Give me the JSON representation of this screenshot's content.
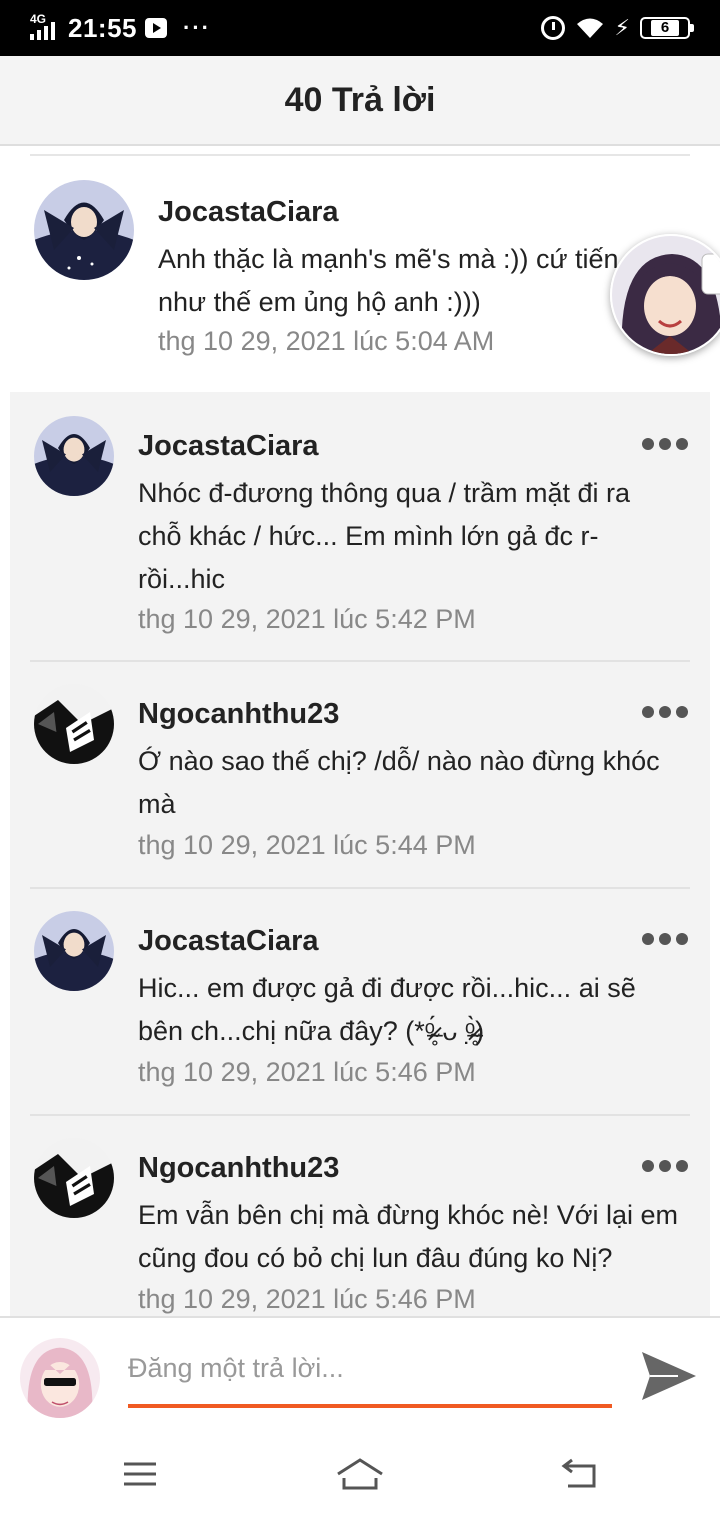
{
  "status_bar": {
    "network": "4G",
    "time": "21:55",
    "more": "···",
    "battery_level": "6"
  },
  "header": {
    "title": "40 Trả lời"
  },
  "main_comment": {
    "author": "JocastaCiara",
    "text": "Anh thặc là mạnh's mẽ's mà :)) cứ tiến như thế em ủng hộ anh :)))",
    "time": "thg 10 29, 2021 lúc 5:04 AM"
  },
  "replies": [
    {
      "author": "JocastaCiara",
      "text": "Nhóc đ-đương thông qua / trầm mặt đi ra chỗ khác / hức... Em mình lớn gả đc r-rồi...hic",
      "time": "thg 10 29, 2021 lúc 5:42 PM",
      "avatar": "dark-character-avatar"
    },
    {
      "author": "Ngocanhthu23",
      "text": "Ớ nào sao thế chị? /dỗ/ nào nào đừng khóc mà",
      "time": "thg 10 29, 2021 lúc 5:44 PM",
      "avatar": "manga-avatar"
    },
    {
      "author": "JocastaCiara",
      "text": "Hic... em được gả đi được rồi...hic... ai sẽ bên ch...chị nữa đây? (*ᵒ̴̶̷̥́ ᴗ ᵒ̴̶̷̣̥̀)",
      "time": "thg 10 29, 2021 lúc 5:46 PM",
      "avatar": "dark-character-avatar"
    },
    {
      "author": "Ngocanhthu23",
      "text": "Em vẫn bên chị mà đừng khóc nè! Với lại em cũng đou có bỏ chị lun đâu đúng ko Nị?",
      "time": "thg 10 29, 2021 lúc 5:46 PM",
      "avatar": "manga-avatar"
    }
  ],
  "composer": {
    "placeholder": "Đăng một trả lời..."
  },
  "colors": {
    "accent": "#f05a22",
    "text": "#222222",
    "muted": "#888888",
    "reply_bg": "#f3f3f3"
  },
  "icons": [
    "send-icon",
    "menu-icon",
    "home-icon",
    "back-icon",
    "more-icon"
  ]
}
